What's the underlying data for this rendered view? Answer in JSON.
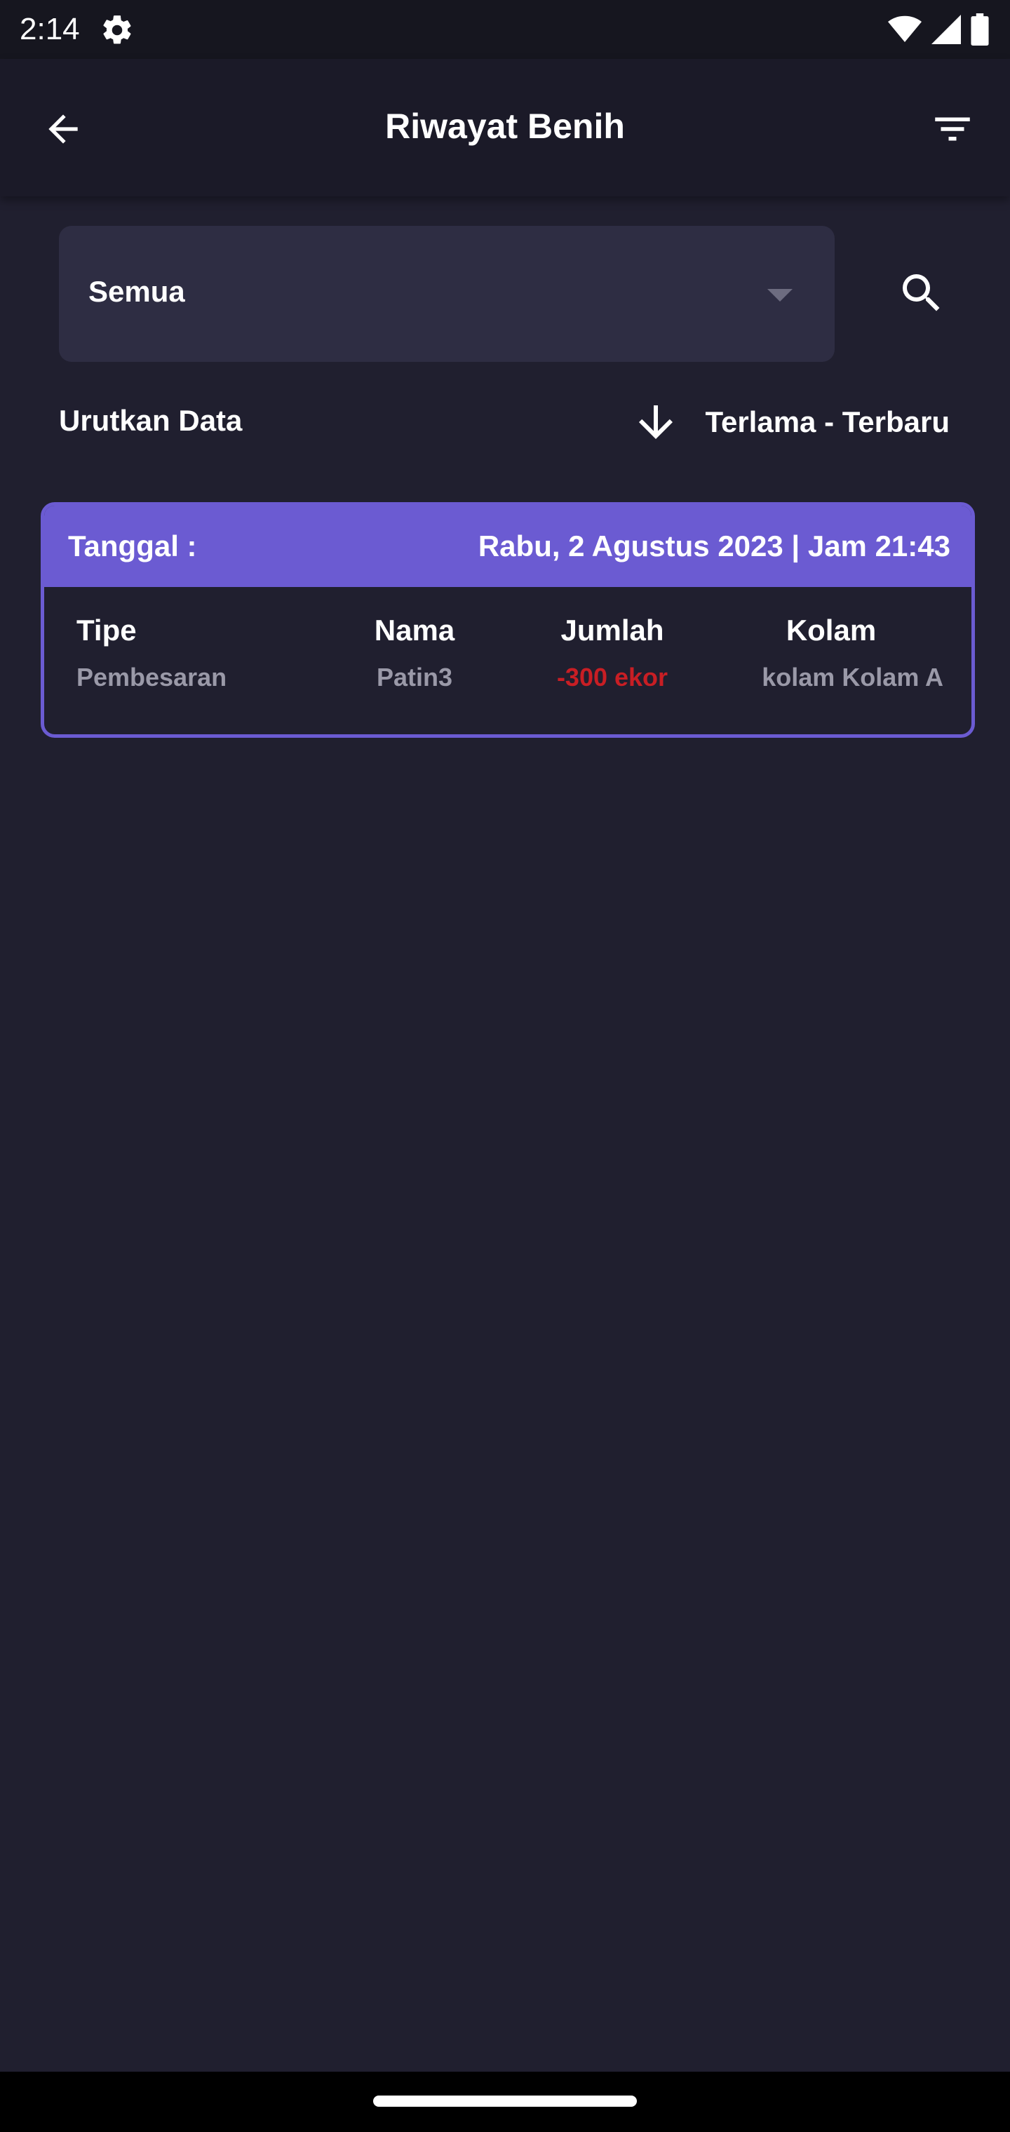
{
  "status_bar": {
    "time": "2:14"
  },
  "app_bar": {
    "title": "Riwayat Benih"
  },
  "filter": {
    "selected": "Semua"
  },
  "sort": {
    "label": "Urutkan Data",
    "order": "Terlama - Terbaru"
  },
  "records": [
    {
      "date_label": "Tanggal :",
      "date_value": "Rabu, 2 Agustus 2023 | Jam 21:43",
      "columns": [
        {
          "header": "Tipe",
          "value": "Pembesaran"
        },
        {
          "header": "Nama",
          "value": "Patin3"
        },
        {
          "header": "Jumlah",
          "value": "-300 ekor",
          "value_color": "#c81e24"
        },
        {
          "header": "Kolam",
          "value": "kolam Kolam A"
        }
      ]
    }
  ],
  "colors": {
    "background": "#201f2f",
    "accent": "#6b5bd2",
    "negative": "#c81e24"
  },
  "icons": {
    "back": "arrow-left-icon",
    "filter": "filter-icon",
    "search": "search-icon",
    "sort": "arrow-down-icon",
    "dropdown": "caret-down-icon"
  }
}
